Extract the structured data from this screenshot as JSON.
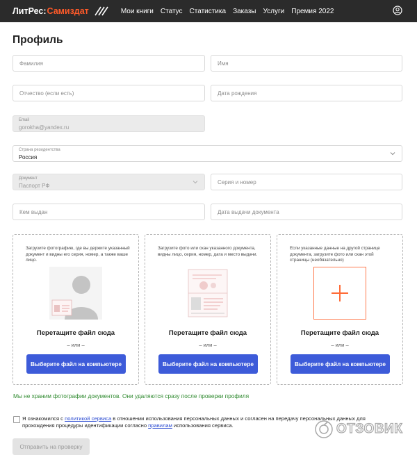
{
  "header": {
    "logo_part1": "ЛитРес:",
    "logo_part2": "Самиздат",
    "nav": [
      "Мои книги",
      "Статус",
      "Статистика",
      "Заказы",
      "Услуги",
      "Премия 2022"
    ],
    "user_icon": "user-circle-icon"
  },
  "page": {
    "title": "Профиль"
  },
  "form": {
    "last_name_placeholder": "Фамилия",
    "first_name_placeholder": "Имя",
    "patronymic_placeholder": "Отчество (если есть)",
    "birthdate_placeholder": "Дата рождения",
    "email_label": "Email",
    "email_value": "gorokha@yandex.ru",
    "country_label": "Страна резидентства",
    "country_value": "Россия",
    "document_label": "Документ",
    "document_value": "Паспорт РФ",
    "series_number_placeholder": "Серия и номер",
    "issued_by_placeholder": "Кем выдан",
    "issue_date_placeholder": "Дата выдачи документа"
  },
  "uploads": [
    {
      "description": "Загрузите фотографию, где вы держите указанный документ и видны его серия, номер, а также ваше лицо.",
      "drop_text": "Перетащите файл сюда",
      "or_text": "– или –",
      "button_label": "Выберите файл на компьютере"
    },
    {
      "description": "Загрузите фото или скан указанного документа, видны лицо, серия, номер, дата и место выдачи.",
      "drop_text": "Перетащите файл сюда",
      "or_text": "– или –",
      "button_label": "Выберите файл на компьютере"
    },
    {
      "description": "Если указанные данные на другой странице документа, загрузите фото или скан этой страницы (необязательно)",
      "drop_text": "Перетащите файл сюда",
      "or_text": "– или –",
      "button_label": "Выберите файл на компьютере"
    }
  ],
  "note": "Мы не храним фотографии документов. Они удаляются сразу после проверки профиля",
  "consent": {
    "text1": "Я ознакомился с ",
    "link1": "политикой сервиса",
    "text2": " в отношении использования персональных данных и согласен на передачу персональных данных для прохождения процедуры идентификации согласно ",
    "link2": "правилам",
    "text3": " использования сервиса."
  },
  "submit_label": "Отправить на проверку",
  "watermark": "ОТЗОВИК",
  "colors": {
    "header_bg": "#2b2b2b",
    "brand_accent": "#ff5a29",
    "button_blue": "#3d5bd9",
    "note_green": "#2f8a2f",
    "link_blue": "#2b4bd1"
  }
}
